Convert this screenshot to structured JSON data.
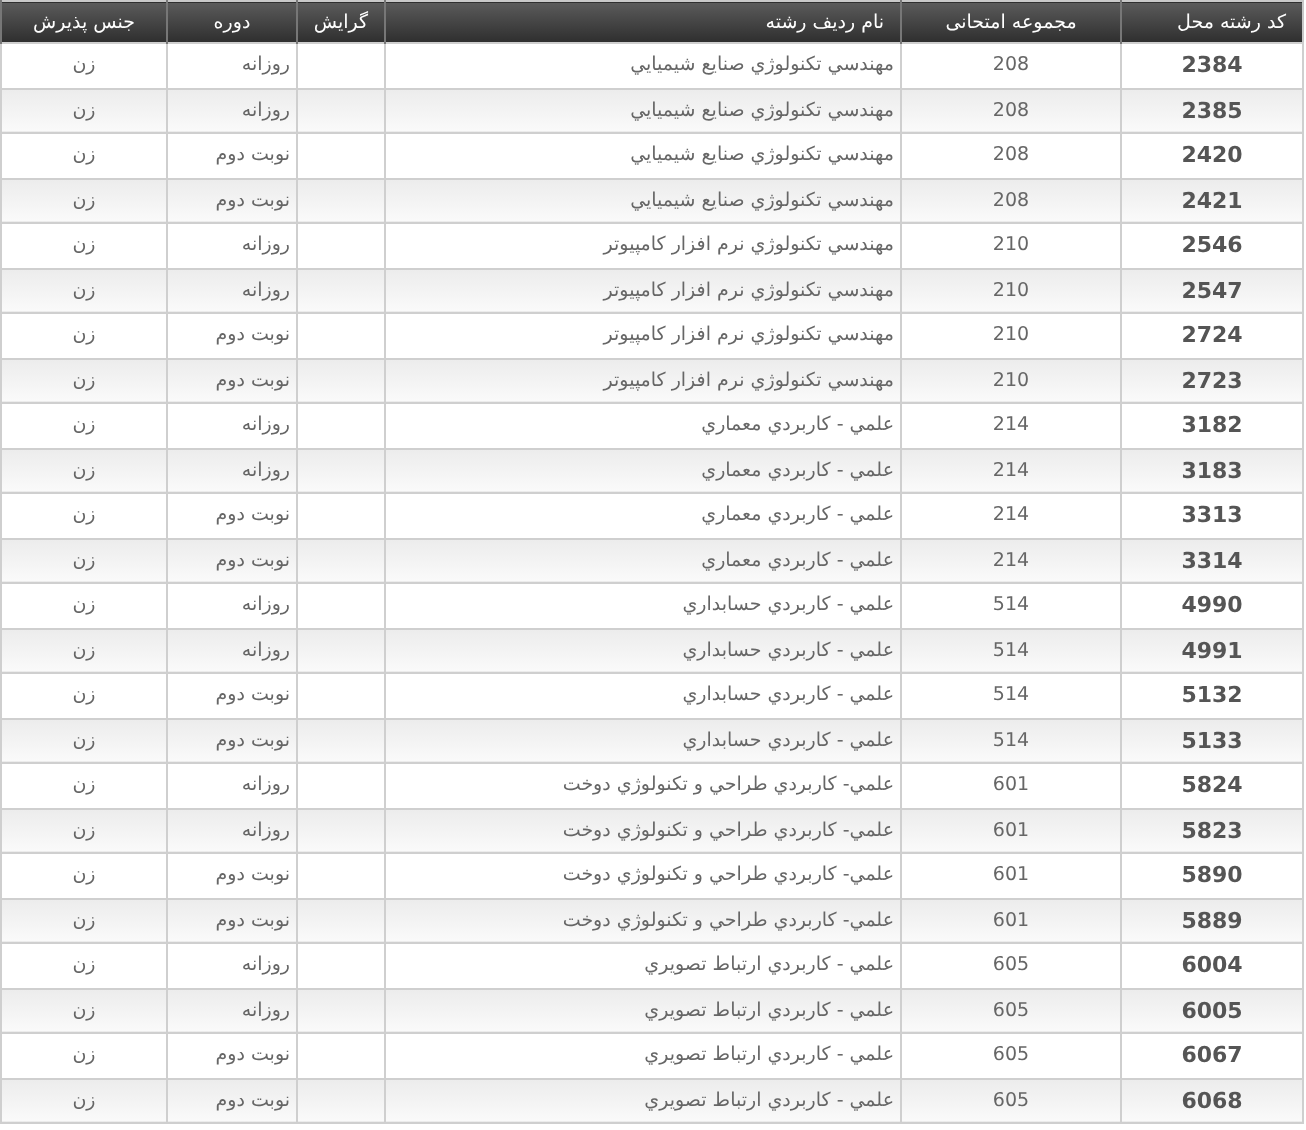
{
  "table": {
    "columns": [
      "کد رشته محل",
      "مجموعه امتحانی",
      "نام ردیف رشته",
      "گرایش",
      "دوره",
      "جنس پذیرش"
    ],
    "rows": [
      {
        "code": "2384",
        "group": "208",
        "name": "مهندسي تكنولوژي صنايع شيميايي",
        "period": "روزانه",
        "gender": "زن"
      },
      {
        "code": "2385",
        "group": "208",
        "name": "مهندسي تكنولوژي صنايع شيميايي",
        "period": "روزانه",
        "gender": "زن"
      },
      {
        "code": "2420",
        "group": "208",
        "name": "مهندسي تكنولوژي صنايع شيميايي",
        "period": "نوبت دوم",
        "gender": "زن"
      },
      {
        "code": "2421",
        "group": "208",
        "name": "مهندسي تكنولوژي صنايع شيميايي",
        "period": "نوبت دوم",
        "gender": "زن"
      },
      {
        "code": "2546",
        "group": "210",
        "name": "مهندسي تكنولوژي نرم افزار كامپيوتر",
        "period": "روزانه",
        "gender": "زن"
      },
      {
        "code": "2547",
        "group": "210",
        "name": "مهندسي تكنولوژي نرم افزار كامپيوتر",
        "period": "روزانه",
        "gender": "زن"
      },
      {
        "code": "2724",
        "group": "210",
        "name": "مهندسي تكنولوژي نرم افزار كامپيوتر",
        "period": "نوبت دوم",
        "gender": "زن"
      },
      {
        "code": "2723",
        "group": "210",
        "name": "مهندسي تكنولوژي نرم افزار كامپيوتر",
        "period": "نوبت دوم",
        "gender": "زن"
      },
      {
        "code": "3182",
        "group": "214",
        "name": "علمي - كاربردي معماري",
        "period": "روزانه",
        "gender": "زن"
      },
      {
        "code": "3183",
        "group": "214",
        "name": "علمي - كاربردي معماري",
        "period": "روزانه",
        "gender": "زن"
      },
      {
        "code": "3313",
        "group": "214",
        "name": "علمي - كاربردي معماري",
        "period": "نوبت دوم",
        "gender": "زن"
      },
      {
        "code": "3314",
        "group": "214",
        "name": "علمي - كاربردي معماري",
        "period": "نوبت دوم",
        "gender": "زن"
      },
      {
        "code": "4990",
        "group": "514",
        "name": "علمي - كاربردي حسابداري",
        "period": "روزانه",
        "gender": "زن"
      },
      {
        "code": "4991",
        "group": "514",
        "name": "علمي - كاربردي حسابداري",
        "period": "روزانه",
        "gender": "زن"
      },
      {
        "code": "5132",
        "group": "514",
        "name": "علمي - كاربردي حسابداري",
        "period": "نوبت دوم",
        "gender": "زن"
      },
      {
        "code": "5133",
        "group": "514",
        "name": "علمي - كاربردي حسابداري",
        "period": "نوبت دوم",
        "gender": "زن"
      },
      {
        "code": "5824",
        "group": "601",
        "name": "علمي- كاربردي طراحي و تكنولوژي دوخت",
        "period": "روزانه",
        "gender": "زن"
      },
      {
        "code": "5823",
        "group": "601",
        "name": "علمي- كاربردي طراحي و تكنولوژي دوخت",
        "period": "روزانه",
        "gender": "زن"
      },
      {
        "code": "5890",
        "group": "601",
        "name": "علمي- كاربردي طراحي و تكنولوژي دوخت",
        "period": "نوبت دوم",
        "gender": "زن"
      },
      {
        "code": "5889",
        "group": "601",
        "name": "علمي- كاربردي طراحي و تكنولوژي دوخت",
        "period": "نوبت دوم",
        "gender": "زن"
      },
      {
        "code": "6004",
        "group": "605",
        "name": "علمي - كاربردي ارتباط تصويري",
        "period": "روزانه",
        "gender": "زن"
      },
      {
        "code": "6005",
        "group": "605",
        "name": "علمي - كاربردي ارتباط تصويري",
        "period": "روزانه",
        "gender": "زن"
      },
      {
        "code": "6067",
        "group": "605",
        "name": "علمي - كاربردي ارتباط تصويري",
        "period": "نوبت دوم",
        "gender": "زن"
      },
      {
        "code": "6068",
        "group": "605",
        "name": "علمي - كاربردي ارتباط تصويري",
        "period": "نوبت دوم",
        "gender": "زن"
      }
    ]
  }
}
